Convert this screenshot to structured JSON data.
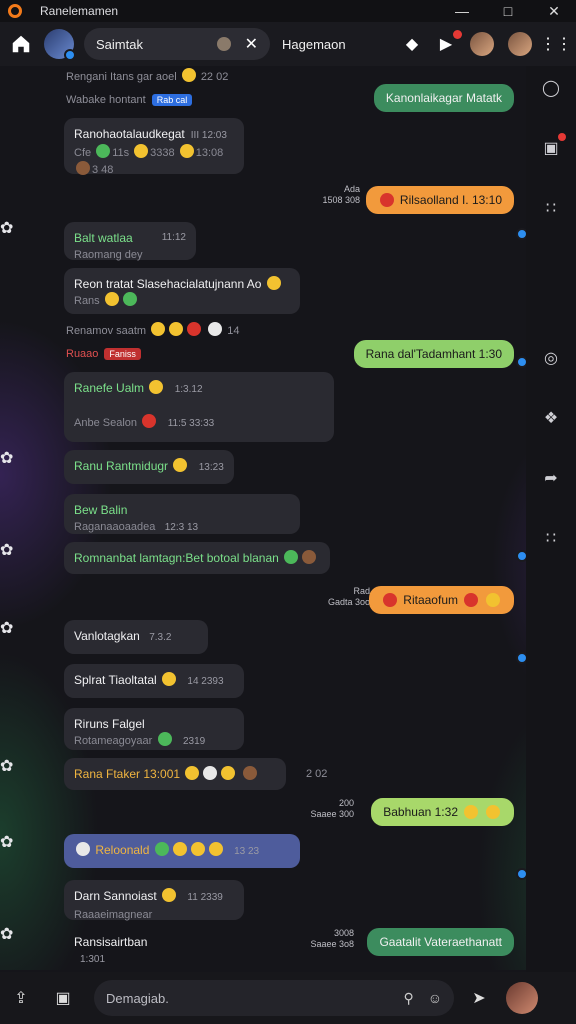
{
  "window": {
    "title": "Ranelemamen"
  },
  "header": {
    "search_value": "Saimtak",
    "chat_name": "Hagemaon"
  },
  "colors": {
    "accent": "#f27a1a",
    "outgoing_green": "#8fcf6a",
    "outgoing_orange": "#f29a3c",
    "badge_blue": "#2d8ef0"
  },
  "messages": {
    "m0": {
      "text": "Rengani Itans gar aoel",
      "meta": "22 02"
    },
    "m1": {
      "text": "Kanonlaikagar Matatk"
    },
    "m2": {
      "text": "Wabake hontant",
      "tag": "Rab cal"
    },
    "m3": {
      "name": "Ranohaotalaudkegat",
      "time": "III 12:03",
      "r1": "Cfe",
      "r2": "11s",
      "r3": "3338",
      "r4": "13:08",
      "r5": "3 48"
    },
    "m4": {
      "meta_top": "Ada",
      "meta_bot": "1508 308",
      "text": "Rilsaolland I. 13:10"
    },
    "m5": {
      "name": "Balt watlaa",
      "sub": "Raomang dey",
      "time": "11:12"
    },
    "m6": {
      "text": "Reon tratat Slasehacialatujnann Ao",
      "sub": "Rans"
    },
    "m7": {
      "text": "Renamov saatm",
      "meta": "14"
    },
    "m8": {
      "text": "Ruaao",
      "tag": "Faniss",
      "out": "Rana dal'Tadamhant 1:30"
    },
    "m9": {
      "name": "Ranefe Ualm",
      "time": "1:3.12",
      "sub": "Anbe Sealon",
      "sub2": "11:5 33:33"
    },
    "m10": {
      "name": "Ranu Rantmidugr",
      "time": "13:23"
    },
    "m11": {
      "name": "Bew Balin",
      "sub": "Raganaaoaadea",
      "time": "12:3 13"
    },
    "m12": {
      "text": "Romnanbat lamtagn:Bet botoal blanan"
    },
    "m13": {
      "meta_top": "Rad",
      "meta_bot": "Gadta 3oo",
      "text": "Ritaaofum"
    },
    "m14": {
      "name": "Vanlotagkan",
      "time": "7.3.2"
    },
    "m15": {
      "name": "Splrat Tiaoltatal",
      "time": "14 2393"
    },
    "m16": {
      "name": "Riruns Falgel",
      "sub": "Rotameagoyaar",
      "time": "2319"
    },
    "m17": {
      "name": "Rana Ftaker 13:001",
      "meta": "2 02"
    },
    "m18": {
      "meta_top": "200",
      "meta_bot": "Saaee 300",
      "text": "Babhuan 1:32"
    },
    "m19": {
      "name": "Reloonald",
      "time": "13 23"
    },
    "m20": {
      "name": "Darn Sannoiast",
      "sub": "Raaaeimagnear",
      "time": "11 2339"
    },
    "m21": {
      "name": "Ransisairtban",
      "time": "1:301",
      "meta_top": "3008",
      "meta_bot": "Saaee 3o8",
      "out": "Gaatalit Vateraethanatt"
    }
  },
  "composer": {
    "placeholder": "Demagiab."
  }
}
